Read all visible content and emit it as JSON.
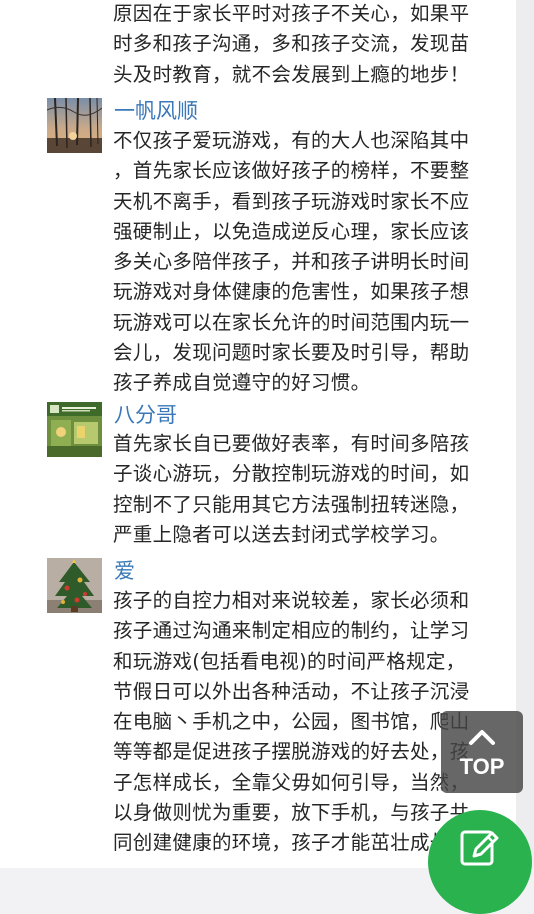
{
  "comments": [
    {
      "lines": [
        "原因在于家长平时对孩子不关心，如果平",
        "时多和孩子沟通，多和孩子交流，发现苗",
        "头及时教育，就不会发展到上瘾的地步！"
      ]
    },
    {
      "username": "一帆风顺",
      "avatar": "sunset-trees",
      "lines": [
        "不仅孩子爱玩游戏，有的大人也深陷其中",
        "，首先家长应该做好孩子的榜样，不要整",
        "天机不离手，看到孩子玩游戏时家长不应",
        "强硬制止，以免造成逆反心理，家长应该",
        "多关心多陪伴孩子，并和孩子讲明长时间",
        "玩游戏对身体健康的危害性，如果孩子想",
        "玩游戏可以在家长允许的时间范围内玩一",
        "会儿，发现问题时家长要及时引导，帮助",
        "孩子养成自觉遵守的好习惯。"
      ]
    },
    {
      "username": "八分哥",
      "avatar": "bank-storefront",
      "lines": [
        "首先家长自已要做好表率，有时间多陪孩",
        "子谈心游玩，分散控制玩游戏的时间，如",
        "控制不了只能用其它方法强制扭转迷隐，",
        "严重上隐者可以送去封闭式学校学习。"
      ]
    },
    {
      "username": "爱",
      "avatar": "christmas-tree",
      "lines": [
        "孩子的自控力相对来说较差，家长必须和",
        "孩子通过沟通来制定相应的制约，让学习",
        "和玩游戏(包括看电视)的时间严格规定，",
        "节假日可以外出各种活动，不让孩子沉浸",
        "在电脑丶手机之中，公园，图书馆，爬山",
        "等等都是促进孩子摆脱游戏的好去处，孩",
        "子怎样成长，全靠父毋如何引导，当然，",
        "以身做则忧为重要，放下手机，与孩子共",
        "同创建健康的环境，孩子才能茁壮成长。"
      ]
    }
  ],
  "top_button": {
    "label": "TOP",
    "icon": "chevron-up-icon"
  },
  "compose_button": {
    "icon": "pencil-edit-icon"
  },
  "colors": {
    "username": "#3a78b8",
    "body_text": "#262626",
    "fab_green": "#2ab24f",
    "top_button_bg": "#464646"
  }
}
